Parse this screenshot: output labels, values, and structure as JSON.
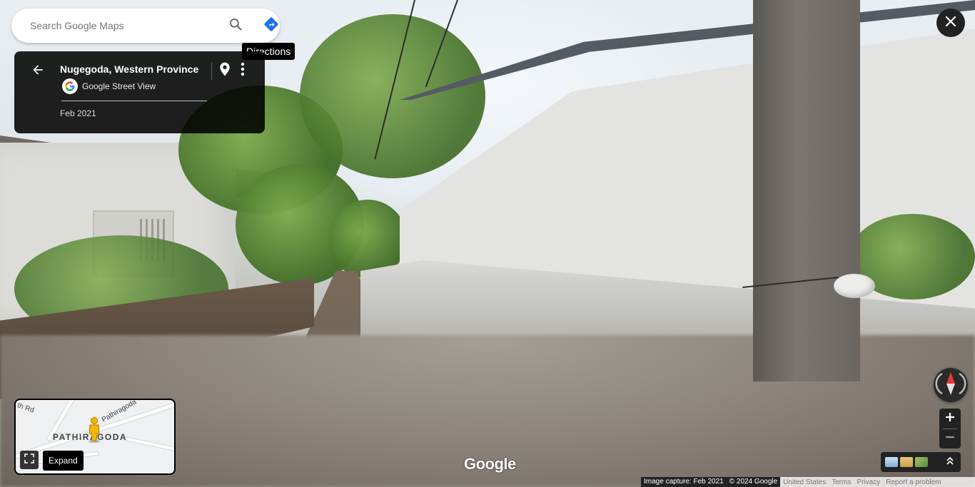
{
  "search": {
    "placeholder": "Search Google Maps"
  },
  "tooltips": {
    "directions": "Directions",
    "expand": "Expand"
  },
  "info_panel": {
    "place_title": "Nugegoda, Western Province",
    "source_label": "Google Street View",
    "capture_date": "Feb 2021"
  },
  "minimap": {
    "district": "PATHIRAGODA",
    "road_1": "Pathiragoda",
    "road_2": "th Rd"
  },
  "wordmark": "Google",
  "footer": {
    "image_capture": "Image capture: Feb 2021",
    "copyright": "© 2024 Google",
    "country": "United States",
    "terms": "Terms",
    "privacy": "Privacy",
    "report": "Report a problem"
  },
  "colors": {
    "directions_blue": "#1a73e8",
    "compass_red": "#e53935",
    "panel_bg": "#000000"
  },
  "icons": [
    "search-icon",
    "directions-icon",
    "back-arrow-icon",
    "google-g-icon",
    "location-pin-icon",
    "more-vert-icon",
    "close-icon",
    "pegman-icon",
    "fullscreen-icon",
    "compass-icon",
    "plus-icon",
    "minus-icon",
    "chevron-up-icon"
  ]
}
